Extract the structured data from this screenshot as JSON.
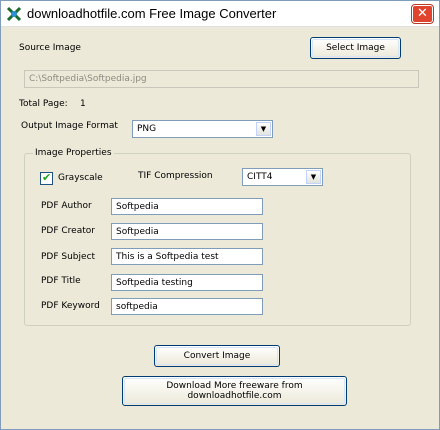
{
  "window": {
    "title": "downloadhotfile.com Free Image Converter",
    "close_glyph": "✕"
  },
  "source": {
    "label": "Source Image",
    "select_button": "Select Image",
    "path": "C:\\Softpedia\\Softpedia.jpg"
  },
  "total_page": {
    "label": "Total Page:",
    "value": "1"
  },
  "output_format": {
    "label": "Output Image Format",
    "selected": "PNG",
    "arrow": "▼"
  },
  "properties": {
    "group_title": "Image Properties",
    "grayscale": {
      "label": "Grayscale",
      "checked": true,
      "mark": "✔"
    },
    "tif_compression": {
      "label": "TIF Compression",
      "selected": "CITT4",
      "arrow": "▼"
    },
    "pdf_author": {
      "label": "PDF Author",
      "value": "Softpedia"
    },
    "pdf_creator": {
      "label": "PDF Creator",
      "value": "Softpedia"
    },
    "pdf_subject": {
      "label": "PDF Subject",
      "value": "This is a Softpedia test"
    },
    "pdf_title": {
      "label": "PDF Title",
      "value": "Softpedia testing"
    },
    "pdf_keyword": {
      "label": "PDF Keyword",
      "value": "softpedia"
    }
  },
  "actions": {
    "convert_button": "Convert Image",
    "download_button": "Download More freeware from downloadhotfile.com"
  },
  "colors": {
    "window_bg": "#ece9d8",
    "close_button": "#e0442e",
    "checkmark": "#21a121",
    "input_border": "#7f9db9"
  }
}
